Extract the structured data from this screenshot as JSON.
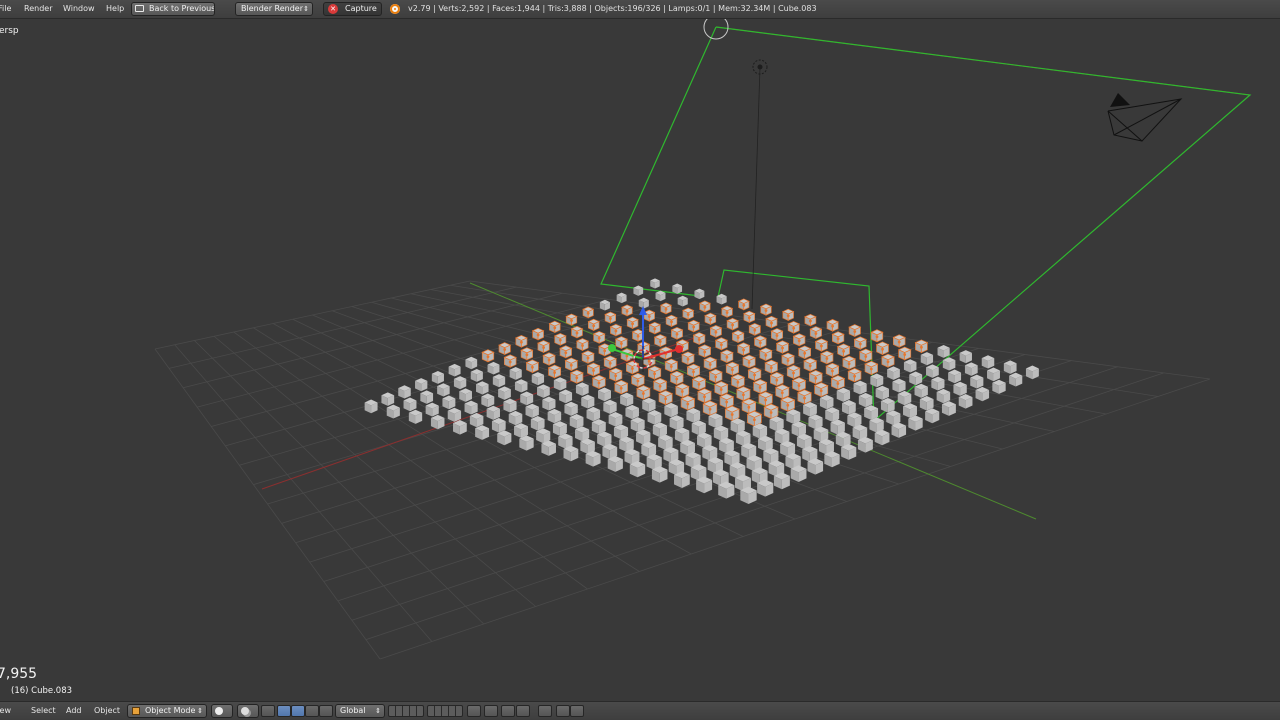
{
  "topbar": {
    "menus": [
      "File",
      "Render",
      "Window",
      "Help"
    ],
    "back_button": "Back to Previous",
    "engine": "Blender Render",
    "capture_button": "Capture",
    "stats": "v2.79 | Verts:2,592 | Faces:1,944 | Tris:3,888 | Objects:196/326 | Lamps:0/1 | Mem:32.34M | Cube.083"
  },
  "viewport": {
    "view_label": "ersp",
    "frame_info": "7,955",
    "object_info": "(16) Cube.083"
  },
  "bottombar": {
    "menus": [
      "View",
      "Select",
      "Add",
      "Object"
    ],
    "mode": "Object Mode",
    "orientation": "Global"
  },
  "colors": {
    "background": "#393939",
    "grid": "#4a4a4a",
    "x_axis": "#8a2f2f",
    "y_axis": "#4e8a2f",
    "selection": "#e8772e",
    "camera_frame": "#2fb82f",
    "cube": "#b7b7b7"
  }
}
